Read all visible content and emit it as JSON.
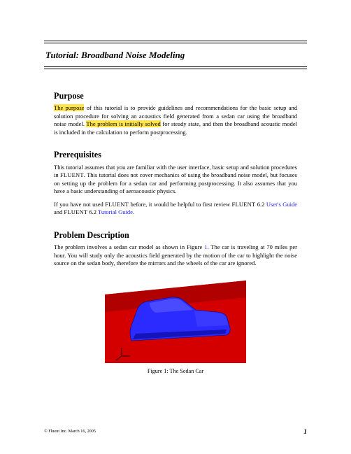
{
  "header": {
    "title": "Tutorial: Broadband Noise Modeling"
  },
  "sections": {
    "purpose": {
      "heading": "Purpose",
      "hl1": "The purpose",
      "t1": " of this tutorial is to provide guidelines and recommendations for the basic setup and solution procedure for solving an acoustics field generated from a sedan car using the broadband noise model. ",
      "hl2": "The problem is initially solved",
      "t2": " for steady state, and then the broadband acoustic model is included in the calculation to perform postprocessing."
    },
    "prereq": {
      "heading": "Prerequisites",
      "p1a": "This tutorial assumes that you are familiar with the user interface, basic setup and solution procedures in ",
      "fluent": "FLUENT",
      "p1b": ". This tutorial does not cover mechanics of using the broadband noise model, but focuses on setting up the problem for a sedan car and performing postprocessing. It also assumes that you have a basic understanding of aeroacoustic physics.",
      "p2a": "If you have not used ",
      "p2b": " before, it would be helpful to first review ",
      "ver": " 6.2 ",
      "link1": "User's Guide",
      "p2c": " and ",
      "link2": "Tutorial Guide",
      "period": "."
    },
    "problem": {
      "heading": "Problem Description",
      "p1a": "The problem involves a sedan car model as shown in Figure ",
      "figref": "1",
      "p1b": ". The car is traveling at 70 miles per hour. You will study only the acoustics field generated by the motion of the car to highlight the noise source on the sedan body, therefore the mirrors and the wheels of the car are ignored."
    }
  },
  "figure": {
    "caption": "Figure 1: The Sedan Car"
  },
  "footer": {
    "copyright": "© Fluent Inc. March 16, 2005",
    "page": "1"
  }
}
